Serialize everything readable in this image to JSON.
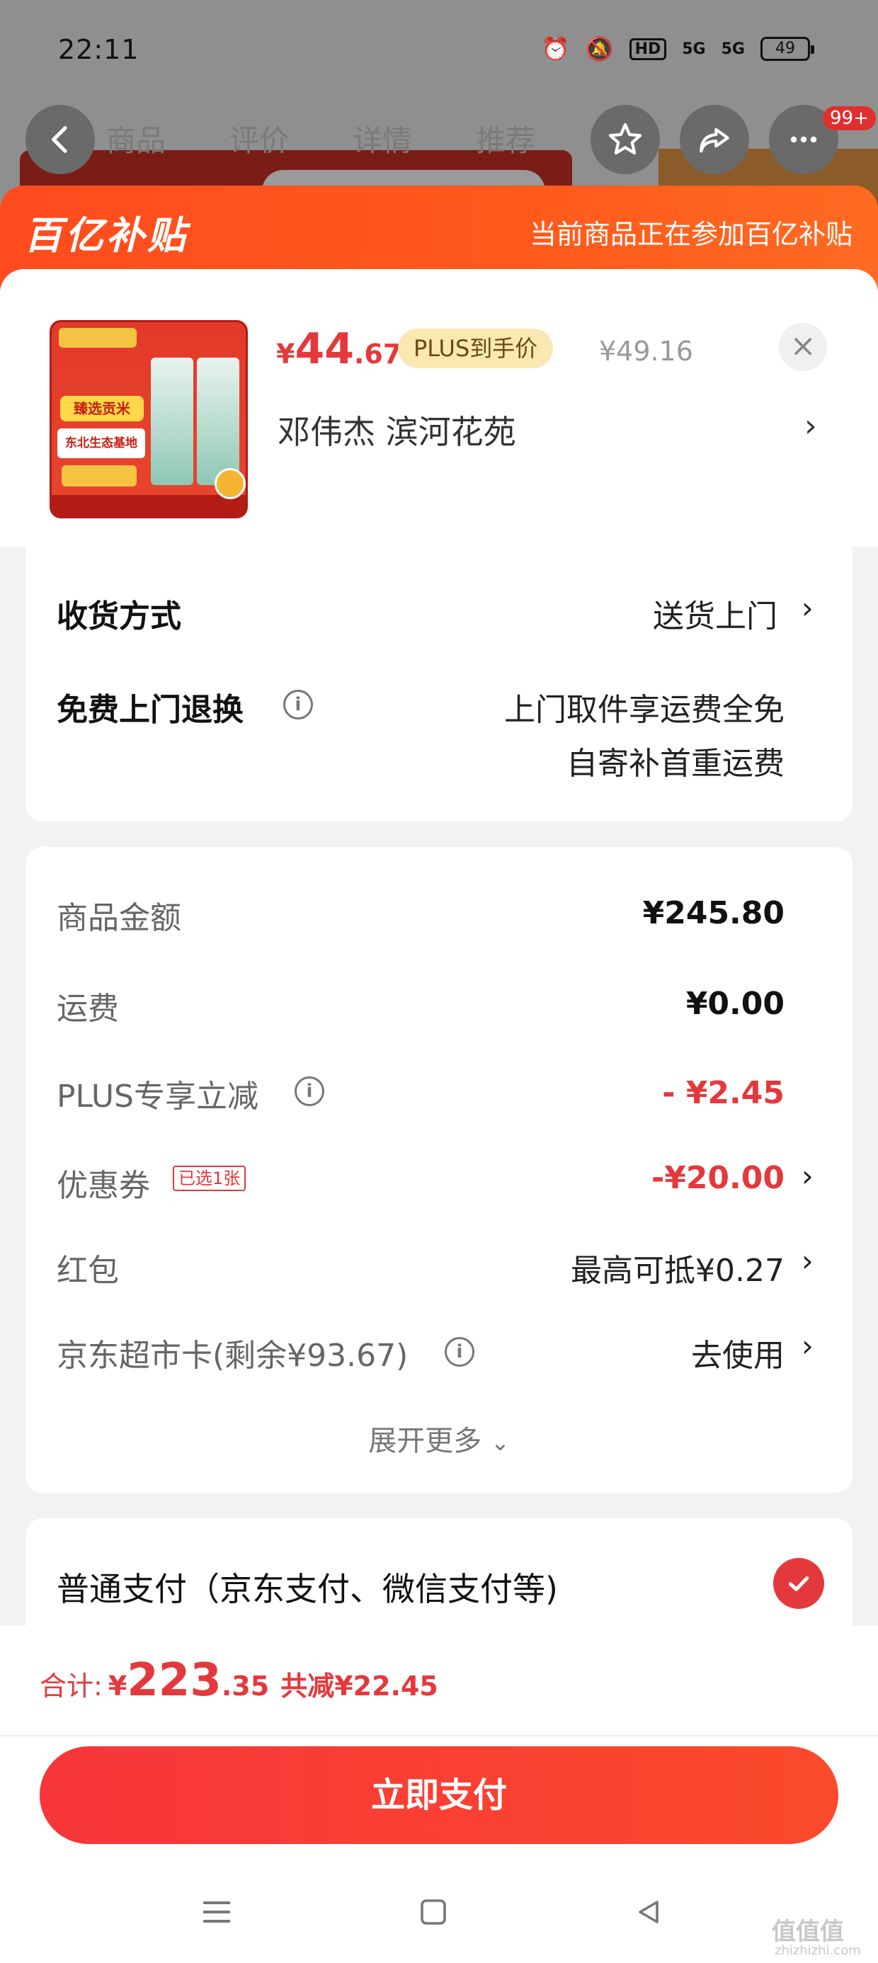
{
  "status_bar": {
    "time": "22:11",
    "hd_label": "HD",
    "signal1": "5G",
    "signal2": "5G",
    "battery": "49"
  },
  "background_app": {
    "tabs": [
      "商品",
      "评价",
      "详情",
      "推荐"
    ],
    "cart_badge": "99+"
  },
  "promo_header": {
    "logo": "百亿补贴",
    "notice": "当前商品正在参加百亿补贴"
  },
  "product": {
    "price_symbol": "¥",
    "price_int": "44",
    "price_dec": ".67",
    "plus_tag": "PLUS到手价",
    "original_price": "¥49.16",
    "address": "邓伟杰  滨河花苑",
    "thumb_tag1": "臻选贡米",
    "thumb_tag2": "东北生态基地"
  },
  "delivery": {
    "method_label": "收货方式",
    "method_value": "送货上门",
    "return_label": "免费上门退换",
    "return_line1": "上门取件享运费全免",
    "return_line2": "自寄补首重运费"
  },
  "fees": {
    "goods_label": "商品金额",
    "goods_value": "¥245.80",
    "shipping_label": "运费",
    "shipping_value": "¥0.00",
    "plus_label": "PLUS专享立减",
    "plus_value": "- ¥2.45",
    "coupon_label": "优惠券",
    "coupon_badge": "已选1张",
    "coupon_value": "-¥20.00",
    "redpack_label": "红包",
    "redpack_value": "最高可抵¥0.27",
    "card_label": "京东超市卡(剩余¥93.67)",
    "card_value": "去使用",
    "expand_label": "展开更多"
  },
  "payment": {
    "method_label": "普通支付（京东支付、微信支付等)"
  },
  "total": {
    "label": "合计:",
    "symbol": "¥",
    "int": "223",
    "dec": ".35",
    "saved": "共减¥22.45"
  },
  "pay_button": "立即支付",
  "watermark": {
    "main": "值值值",
    "sub": "zhizhizhi.com"
  },
  "colors": {
    "accent_red": "#e4393c",
    "header_orange": "#ff4b1f",
    "plus_gold": "#fbe7b0"
  },
  "icons": {
    "back": "chevron-left-icon",
    "favorite": "star-icon",
    "share": "share-icon",
    "more": "more-dots-icon",
    "close": "close-icon",
    "info": "info-icon",
    "check": "check-icon"
  }
}
